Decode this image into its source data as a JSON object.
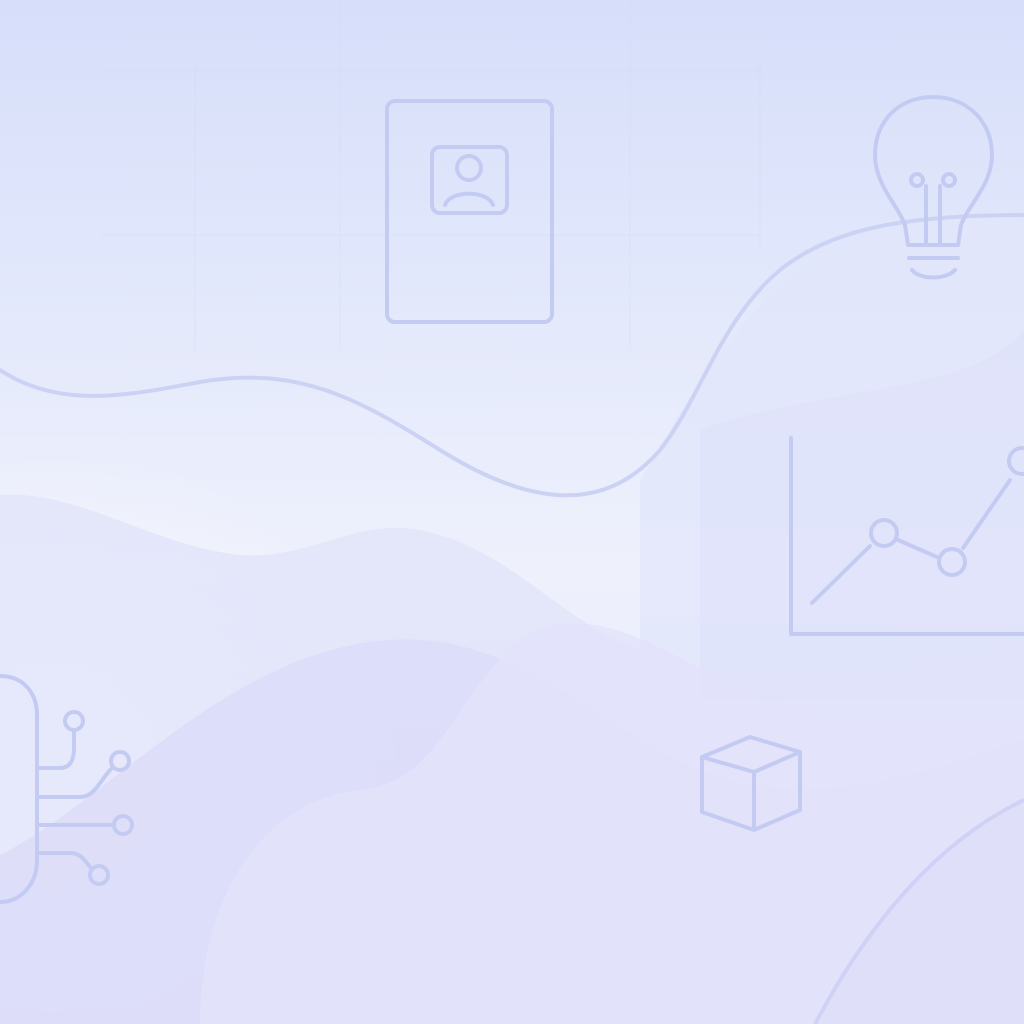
{
  "background": {
    "gradient_top": "#d8e0fb",
    "gradient_mid": "#eef1fc",
    "gradient_bottom": "#e3e3fa",
    "wave_fill": "#d9dcf7",
    "line_color": "#c3cbf3",
    "icon_stroke": "#c4cbf2"
  },
  "icons": [
    "id-card-icon",
    "lightbulb-icon",
    "line-chart-icon",
    "circuit-icon",
    "cube-icon"
  ]
}
